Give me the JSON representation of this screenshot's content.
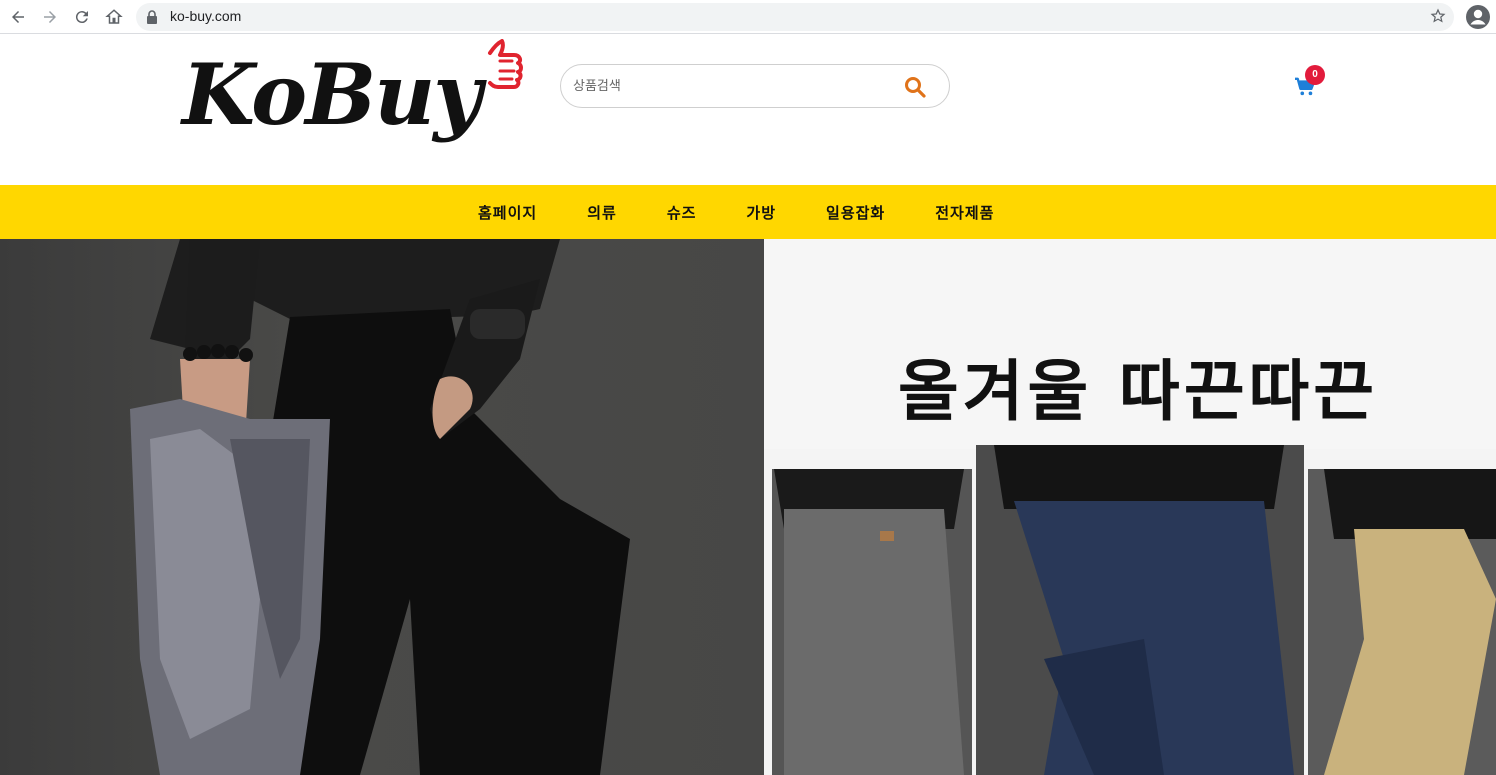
{
  "browser": {
    "url": "ko-buy.com"
  },
  "header": {
    "logo_text": "KoBuy",
    "search_placeholder": "상품검색",
    "cart_count": "0"
  },
  "nav": {
    "items": [
      "홈페이지",
      "의류",
      "슈즈",
      "가방",
      "일용잡화",
      "전자제품"
    ]
  },
  "banner": {
    "headline": "올겨울 따끈따끈"
  },
  "colors": {
    "nav_bg": "#ffd700",
    "search_icon": "#e0731a",
    "cart_icon": "#1e7fd8",
    "badge": "#e21b3c"
  }
}
